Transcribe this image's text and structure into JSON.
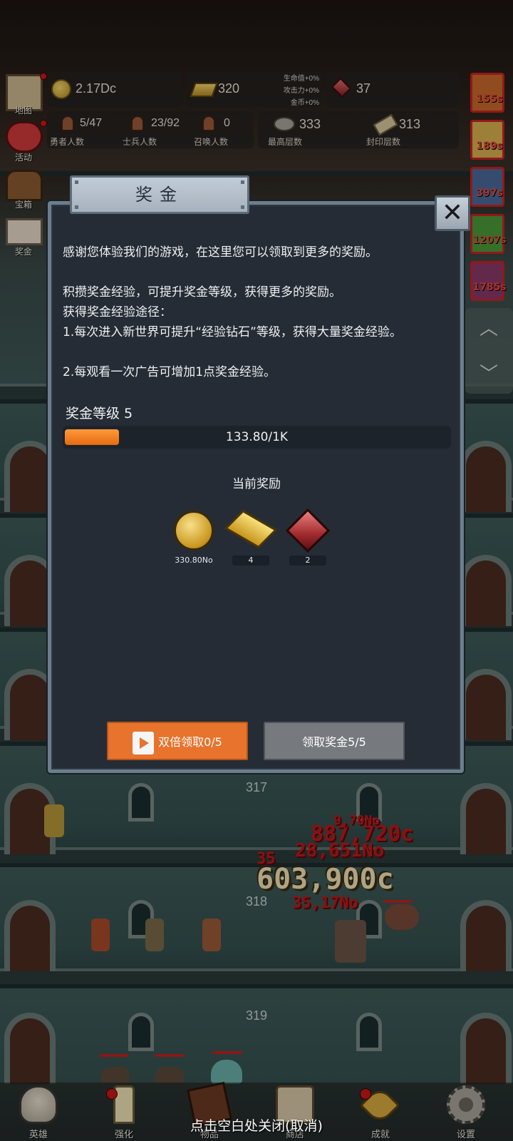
{
  "hud": {
    "coins": "2.17Dc",
    "gold": "320",
    "bonus_hp": "生命值+0%",
    "bonus_atk": "攻击力+0%",
    "bonus_coin": "金币+0%",
    "gems": "37",
    "heroes_value": "5/47",
    "heroes_label": "勇者人数",
    "soldiers_value": "23/92",
    "soldiers_label": "士兵人数",
    "summons_value": "0",
    "summons_label": "召唤人数",
    "highest_floor_value": "333",
    "highest_floor_label": "最高层数",
    "sealed_floor_value": "313",
    "sealed_floor_label": "封印层数"
  },
  "side_menu": [
    {
      "label": "地图",
      "icon": "map-icon"
    },
    {
      "label": "活动",
      "icon": "heart-icon"
    },
    {
      "label": "宝箱",
      "icon": "chest-icon"
    },
    {
      "label": "奖金",
      "icon": "envelope-icon"
    }
  ],
  "buffs": [
    {
      "timer": "155s",
      "color": "#c86a2a"
    },
    {
      "timer": "189s",
      "color": "#d8b050"
    },
    {
      "timer": "397s",
      "color": "#4a6a9a"
    },
    {
      "timer": "1207s",
      "color": "#4a9a3a"
    },
    {
      "timer": "1785s",
      "color": "#8a3a6a"
    }
  ],
  "dialog": {
    "title": "奖金",
    "close": "✕",
    "desc_1": "感谢您体验我们的游戏，在这里您可以领取到更多的奖励。",
    "desc_2": "积攒奖金经验，可提升奖金等级，获得更多的奖励。",
    "desc_3": "获得奖金经验途径：",
    "desc_4": "1.每次进入新世界可提升“经验钻石”等级，获得大量奖金经验。",
    "desc_5": "2.每观看一次广告可增加1点奖金经验。",
    "level_label": "奖金等级 5",
    "progress_text": "133.80/1K",
    "progress_fraction": 0.1338,
    "reward_title": "当前奖励",
    "rewards": [
      {
        "icon": "coin-icon",
        "amount": "330.80No"
      },
      {
        "icon": "gold-bar-icon",
        "amount": "4"
      },
      {
        "icon": "gem-icon",
        "amount": "2"
      }
    ],
    "btn_double": "双倍领取0/5",
    "btn_claim": "领取奖金5/5"
  },
  "floors": [
    "317",
    "318",
    "319"
  ],
  "damage": {
    "big": "603,900c",
    "small": [
      "887,720c",
      "28,651No",
      "35",
      "35,17No",
      "9,70No"
    ]
  },
  "bottom_nav": [
    {
      "label": "英雄",
      "icon": "skull-icon"
    },
    {
      "label": "强化",
      "icon": "candle-icon"
    },
    {
      "label": "物品",
      "icon": "book-icon"
    },
    {
      "label": "商店",
      "icon": "mug-icon"
    },
    {
      "label": "成就",
      "icon": "key-icon"
    },
    {
      "label": "设置",
      "icon": "gear-icon"
    }
  ],
  "close_hint": "点击空白处关闭(取消)"
}
